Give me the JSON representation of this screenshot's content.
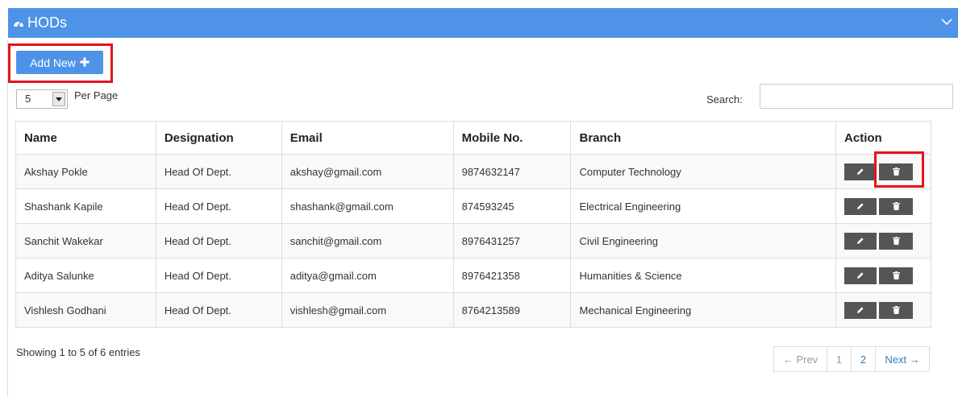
{
  "panel": {
    "title": "HODs",
    "icon": "dashboard-icon"
  },
  "toolbar": {
    "add_label": "Add New",
    "add_icon": "plus-icon"
  },
  "length": {
    "value": "5",
    "label": "Per Page"
  },
  "search": {
    "label": "Search:",
    "value": "",
    "placeholder": ""
  },
  "table": {
    "headers": [
      "Name",
      "Designation",
      "Email",
      "Mobile No.",
      "Branch",
      "Action"
    ],
    "rows": [
      [
        "Akshay Pokle",
        "Head Of Dept.",
        "akshay@gmail.com",
        "9874632147",
        "Computer Technology"
      ],
      [
        "Shashank Kapile",
        "Head Of Dept.",
        "shashank@gmail.com",
        "874593245",
        "Electrical Engineering"
      ],
      [
        "Sanchit Wakekar",
        "Head Of Dept.",
        "sanchit@gmail.com",
        "8976431257",
        "Civil Engineering"
      ],
      [
        "Aditya Salunke",
        "Head Of Dept.",
        "aditya@gmail.com",
        "8976421358",
        "Humanities & Science"
      ],
      [
        "Vishlesh Godhani",
        "Head Of Dept.",
        "vishlesh@gmail.com",
        "8764213589",
        "Mechanical Engineering"
      ]
    ]
  },
  "footer": {
    "info": "Showing 1 to 5 of 6 entries",
    "prev": "← Prev",
    "pages": [
      "1",
      "2"
    ],
    "next": "Next →"
  },
  "colors": {
    "accent": "#4f93e8",
    "highlight": "#e3141d",
    "action_button": "#555555"
  }
}
